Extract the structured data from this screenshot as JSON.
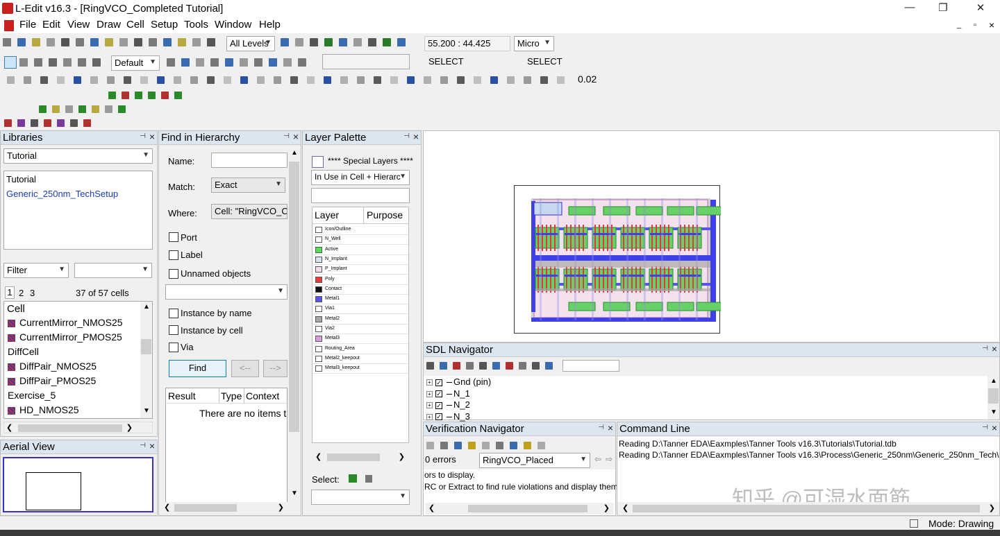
{
  "window": {
    "title": "L-Edit v16.3 - [RingVCO_Completed      Tutorial]",
    "app_icon": "ledit-icon",
    "min": "—",
    "max": "❐",
    "close": "✕"
  },
  "menu": [
    "File",
    "Edit",
    "View",
    "Draw",
    "Cell",
    "Setup",
    "Tools",
    "Window",
    "Help"
  ],
  "mdi_controls": {
    "min": "_",
    "restore": "▫",
    "close": "×"
  },
  "toolbar": {
    "levels": "All Levels",
    "coords": "55.200 : 44.425",
    "units": "Micro",
    "style": "Default",
    "select_a": "SELECT",
    "select_b": "SELECT",
    "snap": "0.02"
  },
  "libraries": {
    "title": "Libraries",
    "selected": "Tutorial",
    "list": [
      "Tutorial",
      "Generic_250nm_TechSetup"
    ],
    "filter_label": "Filter",
    "pages": [
      "1",
      "2",
      "3"
    ],
    "count": "37 of 57 cells",
    "cell_header": "Cell",
    "cells": [
      "CurrentMirror_NMOS25",
      "CurrentMirror_PMOS25",
      "DiffCell",
      "DiffPair_NMOS25",
      "DiffPair_PMOS25",
      "Exercise_5",
      "HD_NMOS25"
    ],
    "cells_icon": [
      true,
      true,
      false,
      true,
      true,
      false,
      true
    ]
  },
  "aerial": {
    "title": "Aerial View"
  },
  "find": {
    "title": "Find in Hierarchy",
    "name_label": "Name:",
    "match_label": "Match:",
    "match_value": "Exact",
    "where_label": "Where:",
    "where_value": "Cell: \"RingVCO_Co",
    "port": "Port",
    "label": "Label",
    "unnamed": "Unnamed objects",
    "inst_name": "Instance by name",
    "inst_cell": "Instance by cell",
    "via": "Via",
    "find_btn": "Find",
    "prev_btn": "<--",
    "next_btn": "-->",
    "cols": [
      "Result",
      "Type",
      "Context"
    ],
    "empty": "There are no items t"
  },
  "layers": {
    "title": "Layer Palette",
    "special": "**** Special Layers ****",
    "mode": "In Use in Cell + Hierarc",
    "col_layer": "Layer",
    "col_purpose": "Purpose",
    "rows": [
      {
        "name": "Icon/Outline",
        "color": "#ffffff"
      },
      {
        "name": "N_Well",
        "color": "#ffffff"
      },
      {
        "name": "Active",
        "color": "#55e055"
      },
      {
        "name": "N_Implant",
        "color": "#d8e4f4"
      },
      {
        "name": "P_Implant",
        "color": "#f6dcec"
      },
      {
        "name": "Poly",
        "color": "#ee3a3a"
      },
      {
        "name": "Contact",
        "color": "#111111"
      },
      {
        "name": "Metal1",
        "color": "#5656ee"
      },
      {
        "name": "Via1",
        "color": "#ffffff"
      },
      {
        "name": "Metal2",
        "color": "#a8a8a8"
      },
      {
        "name": "Via2",
        "color": "#ffffff"
      },
      {
        "name": "Metal3",
        "color": "#d6a0da"
      },
      {
        "name": "Routing_Area",
        "color": "#ffffff"
      },
      {
        "name": "Metal2_keepout",
        "color": "#ffffff"
      },
      {
        "name": "Metal3_keepout",
        "color": "#ffffff"
      }
    ],
    "select_label": "Select:"
  },
  "sdl": {
    "title": "SDL Navigator",
    "nets": [
      "Gnd (pin)",
      "N_1",
      "N_2",
      "N_3"
    ]
  },
  "verify": {
    "title": "Verification Navigator",
    "errors": "0 errors",
    "cell": "RingVCO_Placed",
    "line1": "ors to display.",
    "line2": "RC or Extract to find rule violations and display them"
  },
  "cmd": {
    "title": "Command Line",
    "line1": "Reading D:\\Tanner EDA\\Eaxmples\\Tanner Tools v16.3\\Tutorials\\Tutorial.tdb",
    "line2": "Reading D:\\Tanner EDA\\Eaxmples\\Tanner Tools v16.3\\Process\\Generic_250nm\\Generic_250nm_Tech\\",
    "watermark": "知乎 @可湿水面筋"
  },
  "status": {
    "mode": "Mode: Drawing"
  }
}
